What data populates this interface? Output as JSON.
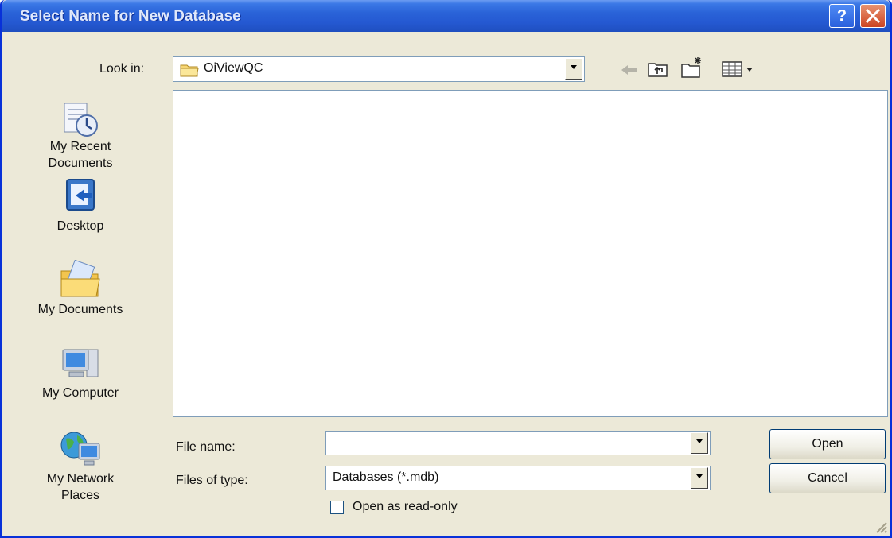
{
  "window": {
    "title": "Select Name for New Database"
  },
  "look_in": {
    "label": "Look in:",
    "value": "OiViewQC"
  },
  "places": [
    {
      "label": "My Recent Documents",
      "icon": "recent-documents-icon"
    },
    {
      "label": "Desktop",
      "icon": "desktop-icon"
    },
    {
      "label": "My Documents",
      "icon": "my-documents-icon"
    },
    {
      "label": "My Computer",
      "icon": "my-computer-icon"
    },
    {
      "label": "My Network Places",
      "icon": "network-places-icon"
    }
  ],
  "file_name": {
    "label": "File name:",
    "value": ""
  },
  "file_type": {
    "label": "Files of type:",
    "value": "Databases (*.mdb)"
  },
  "read_only": {
    "label": "Open as read-only",
    "checked": false
  },
  "buttons": {
    "open": "Open",
    "cancel": "Cancel"
  }
}
